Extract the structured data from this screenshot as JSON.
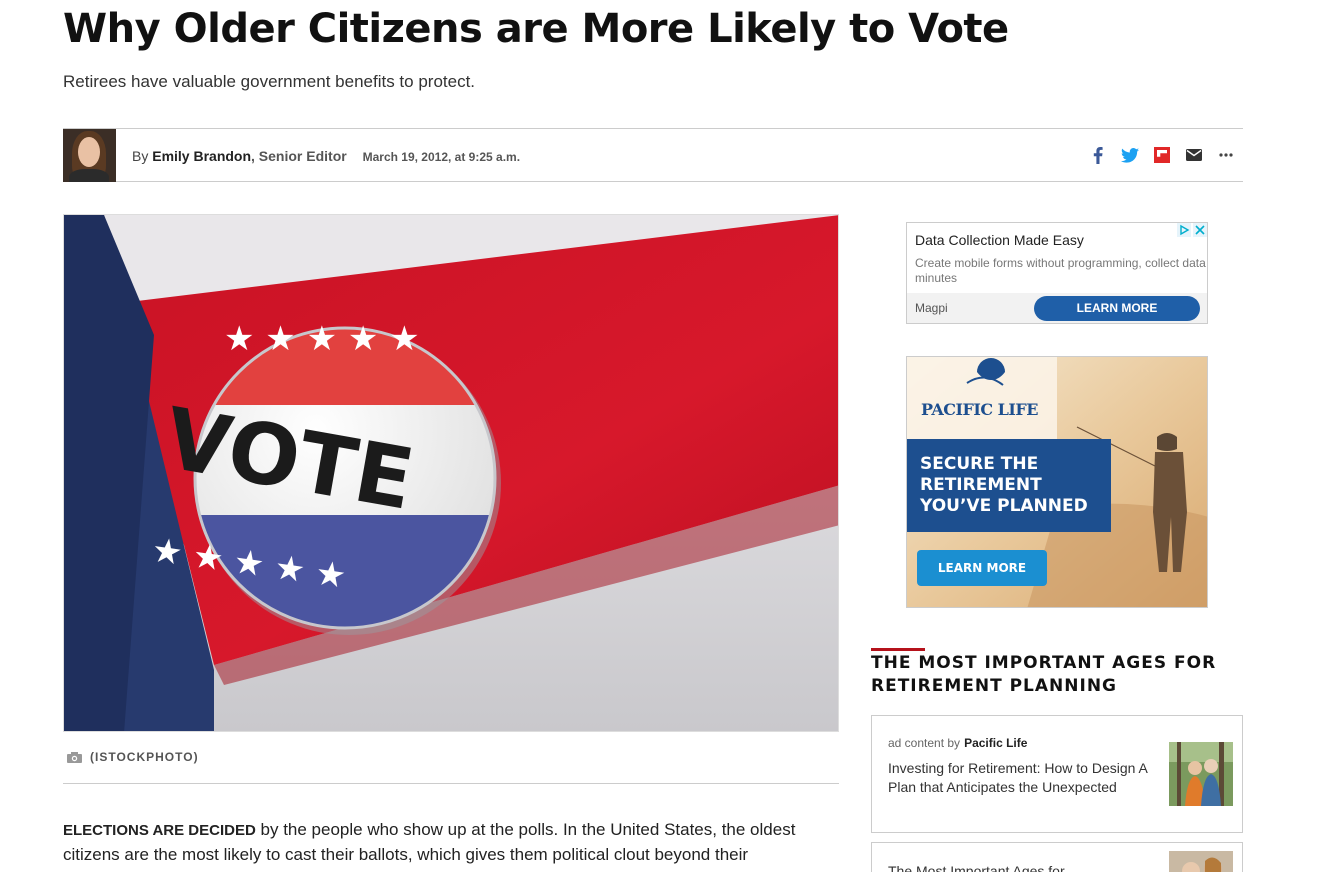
{
  "article": {
    "headline": "Why Older Citizens are More Likely to Vote",
    "subhead": "Retirees have valuable government benefits to protect.",
    "byline_prefix": "By ",
    "author": "Emily Brandon",
    "author_title": ", Senior Editor",
    "date": "March 19, 2012, at 9:25 a.m.",
    "hero_alt": "VOTE",
    "caption": "(ISTOCKPHOTO)",
    "lead_caps": "ELECTIONS ARE DECIDED",
    "lead_text": " by the people who show up at the polls. In the United States, the oldest citizens are the most likely to cast their ballots, which gives them political clout beyond their"
  },
  "share": {
    "icons": [
      "facebook-icon",
      "twitter-icon",
      "flipboard-icon",
      "email-icon",
      "more-icon"
    ],
    "colors": {
      "facebook": "#3b5998",
      "twitter": "#1da1f2",
      "flipboard": "#e12828",
      "email": "#333333"
    }
  },
  "ad_text": {
    "title": "Data Collection Made Easy",
    "description": "Create mobile forms without programming, collect data minutes",
    "brand": "Magpi",
    "cta": "LEARN MORE"
  },
  "ad_display": {
    "logo": "PACIFIC LIFE",
    "headline": "SECURE THE RETIREMENT YOU’VE PLANNED",
    "cta": "LEARN MORE"
  },
  "sidebar": {
    "section_title": "THE MOST IMPORTANT AGES FOR RETIREMENT PLANNING",
    "accent_color": "#b5121b",
    "cards": [
      {
        "meta_prefix": "ad content by",
        "sponsor": "Pacific Life",
        "title": "Investing for Retirement: How to Design A Plan that Anticipates the Unexpected"
      },
      {
        "title": "The Most Important Ages for"
      }
    ]
  }
}
